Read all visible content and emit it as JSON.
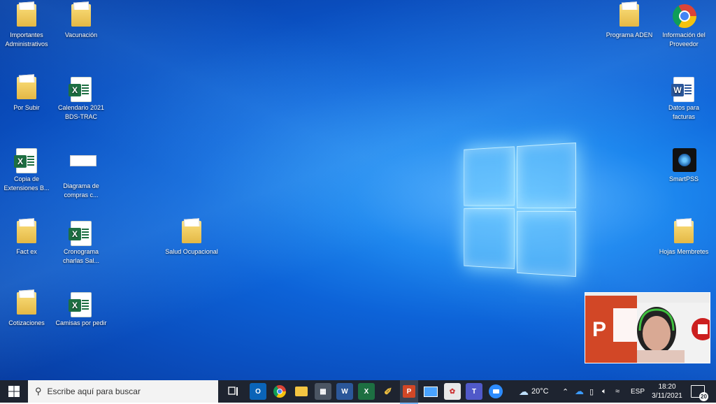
{
  "desktop": {
    "icons": [
      {
        "label": "Importantes Administrativos",
        "type": "folder"
      },
      {
        "label": "Vacunación",
        "type": "folder"
      },
      {
        "label": "Por Subir",
        "type": "folder"
      },
      {
        "label": "Calendario 2021 BDS-TRAC",
        "type": "excel"
      },
      {
        "label": "Copia de Extensiones B...",
        "type": "excel"
      },
      {
        "label": "Diagrama de compras c...",
        "type": "diagram"
      },
      {
        "label": "Fact ex",
        "type": "folder"
      },
      {
        "label": "Cronograma charlas Sal...",
        "type": "excel"
      },
      {
        "label": "Salud Ocupacional",
        "type": "folder"
      },
      {
        "label": "Cotizaciones",
        "type": "folder"
      },
      {
        "label": "Camisas por pedir",
        "type": "excel"
      },
      {
        "label": "Programa ADEN",
        "type": "folder"
      },
      {
        "label": "Información del Proveedor",
        "type": "chrome"
      },
      {
        "label": "Datos para facturas",
        "type": "word"
      },
      {
        "label": "SmartPSS",
        "type": "app"
      },
      {
        "label": "Hojas Membretes",
        "type": "folder"
      }
    ]
  },
  "taskbar": {
    "search_placeholder": "Escribe aquí para buscar",
    "apps": [
      "task-view",
      "outlook",
      "chrome",
      "file-explorer",
      "calculator",
      "word",
      "excel",
      "paint",
      "powerpoint",
      "remote-desktop",
      "photos",
      "teams",
      "zoom"
    ],
    "weather": "20°C",
    "language": "ESP",
    "time": "18:20",
    "date": "3/11/2021",
    "notification_count": "20"
  },
  "colors": {
    "taskbar": "#1e2430",
    "desktop_accent": "#0a63d8",
    "excel": "#1d6f42",
    "word": "#2b579a",
    "powerpoint": "#d24726"
  }
}
